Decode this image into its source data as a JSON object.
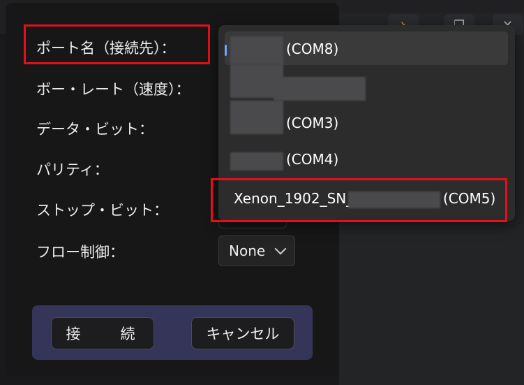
{
  "dialog": {
    "labels": {
      "port": "ポート名（接続先）：",
      "baud": "ボー・レート（速度）：",
      "data_bits": "データ・ビット：",
      "parity": "パリティ：",
      "stop_bits": "ストップ・ビット：",
      "flow": "フロー制御："
    },
    "flow_select": {
      "value": "None"
    },
    "buttons": {
      "connect": "接　続",
      "cancel": "キャンセル"
    }
  },
  "port_dropdown": {
    "items": [
      {
        "label": "(COM8)",
        "selected": true
      },
      {
        "label": ""
      },
      {
        "label": "(COM3)"
      },
      {
        "label": "(COM4)"
      },
      {
        "label_prefix": "Xenon_1902_SN_",
        "label_suffix": "(COM5)"
      }
    ]
  },
  "highlight_color": "#e3101c"
}
